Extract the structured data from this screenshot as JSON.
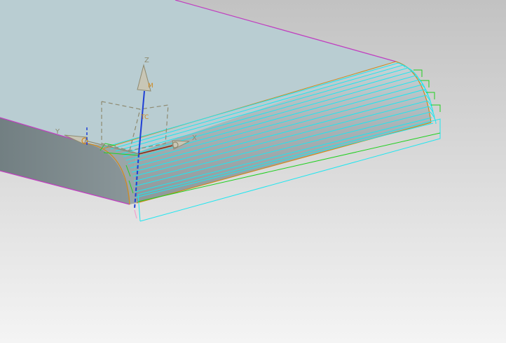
{
  "viewport": {
    "background_top": "#c2c2c2",
    "background_bottom": "#f4f4f4"
  },
  "axes": {
    "z_label": "Z",
    "y_label": "Y",
    "x_label": "X",
    "mcs_label": "M",
    "tool_label": "TC"
  },
  "colors": {
    "top_face": "#b9cdd2",
    "side_face": "#7e8c8f",
    "edge": "#c040c0",
    "fillet_edge": "#d08a20",
    "toolpath": "#1ee6f0",
    "toolpath_engage": "#20d020",
    "axis_z": "#1f3fd6",
    "axis_x": "#8b2a10",
    "triad_gray": "#8e8a70",
    "csys_label": "#d08a20"
  },
  "icons": {
    "z_arrow": "cone-arrow-icon",
    "y_arrow": "cone-arrow-icon",
    "x_arrow": "cone-arrow-icon"
  }
}
